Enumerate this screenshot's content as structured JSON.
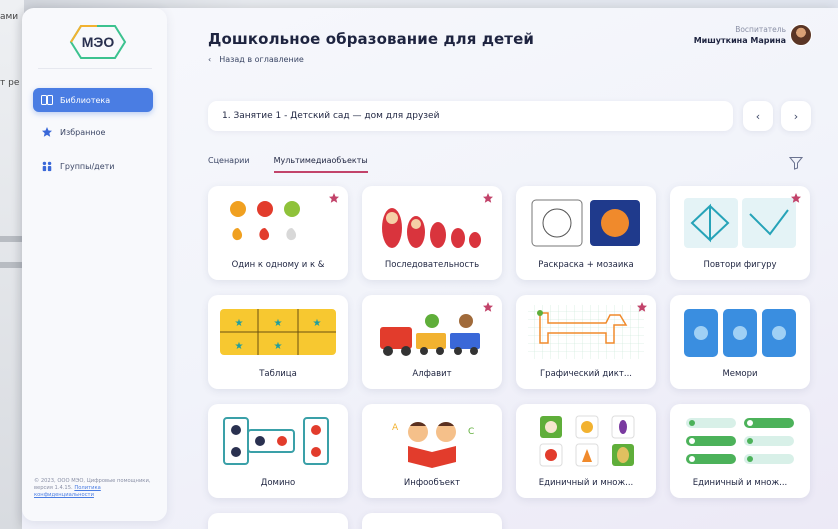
{
  "background": {
    "left_text_top": "ами",
    "left_text_mid": "т ре"
  },
  "sidebar": {
    "logo_text": "МЭО",
    "items": [
      {
        "label": "Библиотека",
        "icon": "library-icon",
        "active": true
      },
      {
        "label": "Избранное",
        "icon": "star-icon",
        "active": false
      },
      {
        "label": "Группы/дети",
        "icon": "group-icon",
        "active": false
      }
    ],
    "footer_text": "© 2023, ООО МЭО, Цифровые помощники, версия 1.4.15.",
    "footer_link": "Политика конфиденциальности"
  },
  "header": {
    "title": "Дошкольное образование для детей",
    "back_label": "Назад в оглавление",
    "user_role": "Воспитатель",
    "user_name": "Мишуткина Марина"
  },
  "lesson": {
    "selected": "1. Занятие 1 - Детский сад — дом для друзей",
    "prev_icon": "chevron-left-icon",
    "next_icon": "chevron-right-icon"
  },
  "tabs": [
    {
      "label": "Сценарии",
      "active": false
    },
    {
      "label": "Мультимедиаобъекты",
      "active": true
    }
  ],
  "cards": [
    {
      "title": "Один к одному и к &",
      "favorite": true
    },
    {
      "title": "Последовательность",
      "favorite": true
    },
    {
      "title": "Раскраска + мозаика",
      "favorite": false
    },
    {
      "title": "Повтори фигуру",
      "favorite": true
    },
    {
      "title": "Таблица",
      "favorite": false
    },
    {
      "title": "Алфавит",
      "favorite": true
    },
    {
      "title": "Графический дикт...",
      "favorite": true
    },
    {
      "title": "Мемори",
      "favorite": false
    },
    {
      "title": "Домино",
      "favorite": false
    },
    {
      "title": "Инфообъект",
      "favorite": false
    },
    {
      "title": "Единичный и множ...",
      "favorite": false
    },
    {
      "title": "Единичный и множ...",
      "favorite": false
    }
  ],
  "colors": {
    "accent": "#4a7de3",
    "tab_underline": "#c2436a",
    "favorite_star": "#c2436a"
  }
}
